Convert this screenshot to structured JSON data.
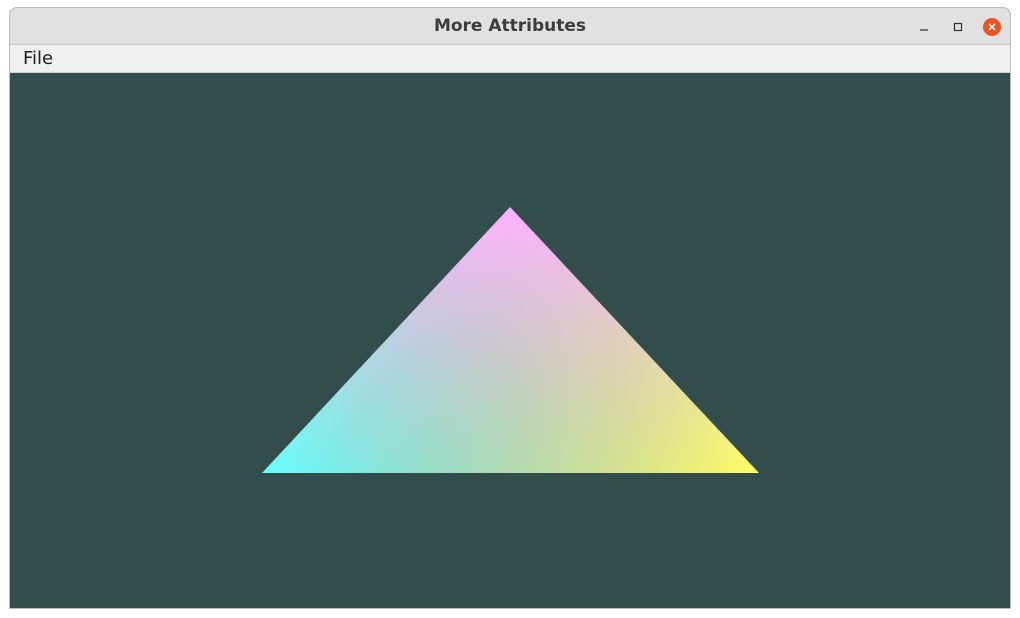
{
  "window": {
    "title": "More Attributes"
  },
  "titlebar_buttons": [
    {
      "name": "minimize",
      "icon": "minimize-icon"
    },
    {
      "name": "maximize",
      "icon": "maximize-icon"
    },
    {
      "name": "close",
      "icon": "close-icon"
    }
  ],
  "menubar": {
    "items": [
      {
        "label": "File"
      }
    ]
  },
  "scene": {
    "clear_color": "#334c4c",
    "triangle": {
      "vertex_colors": {
        "top": "#ff00ff",
        "bottom_left": "#00ffff",
        "bottom_right": "#ffff00"
      }
    }
  },
  "colors": {
    "titlebar": "#e1e1e1",
    "menubar": "#f0f0f0",
    "close_button": "#e95420"
  }
}
